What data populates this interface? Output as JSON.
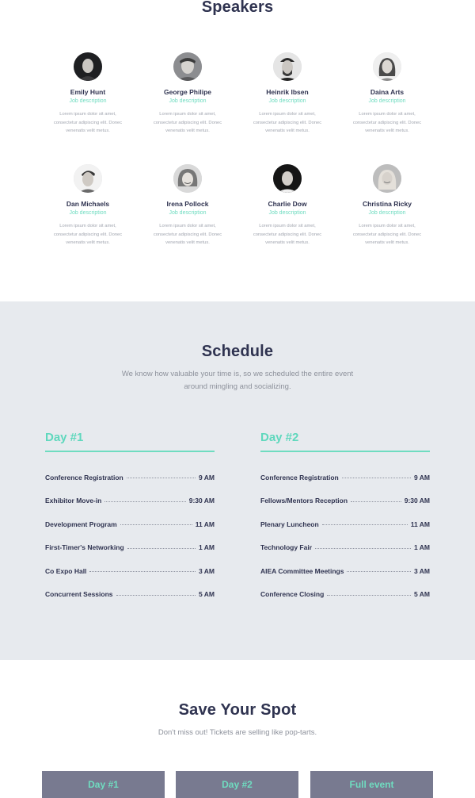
{
  "speakers": {
    "title": "Speakers",
    "items": [
      {
        "name": "Emily Hunt",
        "role": "Job description",
        "desc": "Lorem ipsum dolor sit amet, consectetur adipiscing elit. Donec venenatis velit metus."
      },
      {
        "name": "George Philipe",
        "role": "Job description",
        "desc": "Lorem ipsum dolor sit amet, consectetur adipiscing elit. Donec venenatis velit metus."
      },
      {
        "name": "Heinrik Ibsen",
        "role": "Job description",
        "desc": "Lorem ipsum dolor sit amet, consectetur adipiscing elit. Donec venenatis velit metus."
      },
      {
        "name": "Daina Arts",
        "role": "Job description",
        "desc": "Lorem ipsum dolor sit amet, consectetur adipiscing elit. Donec venenatis velit metus."
      },
      {
        "name": "Dan Michaels",
        "role": "Job description",
        "desc": "Lorem ipsum dolor sit amet, consectetur adipiscing elit. Donec venenatis velit metus."
      },
      {
        "name": "Irena Pollock",
        "role": "Job description",
        "desc": "Lorem ipsum dolor sit amet, consectetur adipiscing elit. Donec venenatis velit metus."
      },
      {
        "name": "Charlie Dow",
        "role": "Job description",
        "desc": "Lorem ipsum dolor sit amet, consectetur adipiscing elit. Donec venenatis velit metus."
      },
      {
        "name": "Christina Ricky",
        "role": "Job description",
        "desc": "Lorem ipsum dolor sit amet, consectetur adipiscing elit. Donec venenatis velit metus."
      }
    ]
  },
  "schedule": {
    "title": "Schedule",
    "subtitle": "We know how valuable your time is, so we scheduled the entire event around mingling and socializing.",
    "days": [
      {
        "title": "Day #1",
        "events": [
          {
            "event": "Conference Registration",
            "time": "9 AM"
          },
          {
            "event": "Exhibitor Move-in",
            "time": "9:30 AM"
          },
          {
            "event": "Development Program",
            "time": "11 AM"
          },
          {
            "event": "First-Timer's Networking",
            "time": "1 AM"
          },
          {
            "event": "Co Expo Hall",
            "time": "3 AM"
          },
          {
            "event": "Concurrent Sessions",
            "time": "5 AM"
          }
        ]
      },
      {
        "title": "Day #2",
        "events": [
          {
            "event": "Conference Registration",
            "time": "9 AM"
          },
          {
            "event": "Fellows/Mentors Reception",
            "time": "9:30 AM"
          },
          {
            "event": "Plenary Luncheon",
            "time": "11 AM"
          },
          {
            "event": "Technology Fair",
            "time": "1 AM"
          },
          {
            "event": "AIEA Committee Meetings",
            "time": "3 AM"
          },
          {
            "event": "Conference Closing",
            "time": "5 AM"
          }
        ]
      }
    ]
  },
  "save": {
    "title": "Save Your Spot",
    "subtitle": "Don't miss out! Tickets are selling like pop-tarts.",
    "buttons": [
      "Day #1",
      "Day #2",
      "Full event"
    ]
  },
  "colors": {
    "accent": "#6fdcc0",
    "heading": "#2f3350",
    "schedule_bg": "#e7eaee",
    "button_bg": "#787a90"
  }
}
